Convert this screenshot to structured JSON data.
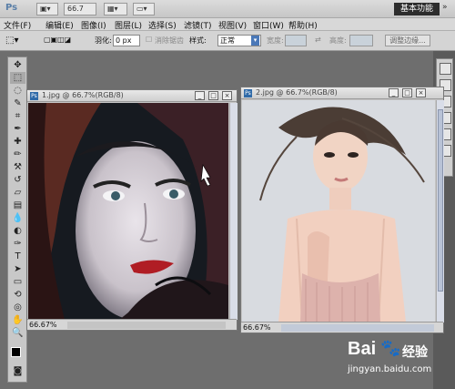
{
  "app": {
    "logo": "Ps",
    "zoom_dropdown": "66.7",
    "workspace_button": "基本功能"
  },
  "menu": [
    "文件(F)",
    "编辑(E)",
    "图像(I)",
    "图层(L)",
    "选择(S)",
    "滤镜(T)",
    "视图(V)",
    "窗口(W)",
    "帮助(H)"
  ],
  "options": {
    "feather_label": "羽化:",
    "feather_value": "0 px",
    "antialias_label": "消除锯齿",
    "style_label": "样式:",
    "style_value": "正常",
    "width_label": "宽度:",
    "height_label": "高度:",
    "refine_edge_button": "调整边缘..."
  },
  "doc1": {
    "title": "1.jpg @ 66.7%(RGB/8)",
    "zoom": "66.67%"
  },
  "doc2": {
    "title": "2.jpg @ 66.7%(RGB/8)",
    "zoom": "66.67%"
  },
  "watermark": {
    "brand": "Bai",
    "brand_suffix": "经验",
    "url": "jingyan.baidu.com"
  }
}
